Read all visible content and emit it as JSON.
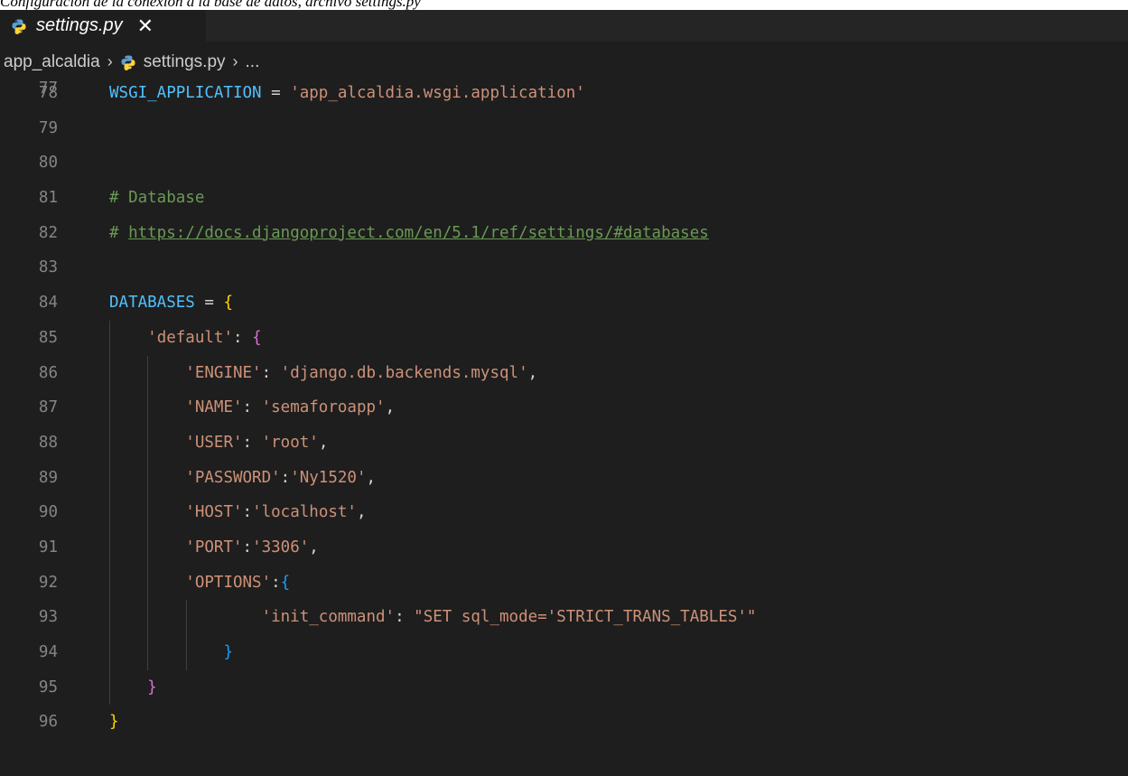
{
  "caption": "Configuración de la conexión a la base de datos, archivo settings.py",
  "tab": {
    "icon": "python-file-icon",
    "label": "settings.py",
    "close_label": "✕"
  },
  "breadcrumb": {
    "folder": "app_alcaldia",
    "sep": "›",
    "file": "settings.py",
    "more": "..."
  },
  "partial_line_number": "77",
  "lines": [
    {
      "n": "78",
      "segs": [
        [
          "WSGI_APPLICATION",
          "kw-var"
        ],
        [
          " = ",
          "op"
        ],
        [
          "'app_alcaldia.wsgi.application'",
          "str"
        ]
      ]
    },
    {
      "n": "79",
      "segs": []
    },
    {
      "n": "80",
      "segs": []
    },
    {
      "n": "81",
      "segs": [
        [
          "# Database",
          "cmt"
        ]
      ]
    },
    {
      "n": "82",
      "segs": [
        [
          "# ",
          "cmt"
        ],
        [
          "https://docs.djangoproject.com/en/5.1/ref/settings/#databases",
          "cmt link"
        ]
      ]
    },
    {
      "n": "83",
      "segs": []
    },
    {
      "n": "84",
      "segs": [
        [
          "DATABASES",
          "kw-var"
        ],
        [
          " = ",
          "op"
        ],
        [
          "{",
          "b1"
        ]
      ]
    },
    {
      "n": "85",
      "segs": [
        [
          "    ",
          "op"
        ],
        [
          "'default'",
          "str"
        ],
        [
          ": ",
          "op"
        ],
        [
          "{",
          "b2"
        ]
      ]
    },
    {
      "n": "86",
      "segs": [
        [
          "        ",
          "op"
        ],
        [
          "'ENGINE'",
          "str"
        ],
        [
          ": ",
          "op"
        ],
        [
          "'django.db.backends.mysql'",
          "str"
        ],
        [
          ",",
          "op"
        ]
      ]
    },
    {
      "n": "87",
      "segs": [
        [
          "        ",
          "op"
        ],
        [
          "'NAME'",
          "str"
        ],
        [
          ": ",
          "op"
        ],
        [
          "'semaforoapp'",
          "str"
        ],
        [
          ",",
          "op"
        ]
      ]
    },
    {
      "n": "88",
      "segs": [
        [
          "        ",
          "op"
        ],
        [
          "'USER'",
          "str"
        ],
        [
          ": ",
          "op"
        ],
        [
          "'root'",
          "str"
        ],
        [
          ",",
          "op"
        ]
      ]
    },
    {
      "n": "89",
      "segs": [
        [
          "        ",
          "op"
        ],
        [
          "'PASSWORD'",
          "str"
        ],
        [
          ":",
          "op"
        ],
        [
          "'Ny1520'",
          "str"
        ],
        [
          ",",
          "op"
        ]
      ]
    },
    {
      "n": "90",
      "segs": [
        [
          "        ",
          "op"
        ],
        [
          "'HOST'",
          "str"
        ],
        [
          ":",
          "op"
        ],
        [
          "'localhost'",
          "str"
        ],
        [
          ",",
          "op"
        ]
      ]
    },
    {
      "n": "91",
      "segs": [
        [
          "        ",
          "op"
        ],
        [
          "'PORT'",
          "str"
        ],
        [
          ":",
          "op"
        ],
        [
          "'3306'",
          "str"
        ],
        [
          ",",
          "op"
        ]
      ]
    },
    {
      "n": "92",
      "segs": [
        [
          "        ",
          "op"
        ],
        [
          "'OPTIONS'",
          "str"
        ],
        [
          ":",
          "op"
        ],
        [
          "{",
          "b3"
        ]
      ]
    },
    {
      "n": "93",
      "segs": [
        [
          "                ",
          "op"
        ],
        [
          "'init_command'",
          "str"
        ],
        [
          ": ",
          "op"
        ],
        [
          "\"SET sql_mode='STRICT_TRANS_TABLES'\"",
          "str"
        ]
      ]
    },
    {
      "n": "94",
      "segs": [
        [
          "            ",
          "op"
        ],
        [
          "}",
          "b3"
        ]
      ]
    },
    {
      "n": "95",
      "segs": [
        [
          "    ",
          "op"
        ],
        [
          "}",
          "b2"
        ]
      ]
    },
    {
      "n": "96",
      "segs": [
        [
          "}",
          "b1"
        ]
      ]
    }
  ],
  "colors": {
    "editor_bg": "#1e1e1e",
    "variable": "#4fc1ff",
    "string": "#ce9178",
    "comment": "#6a9955",
    "bracket_level_1": "#ffd700",
    "bracket_level_2": "#da70d6",
    "bracket_level_3": "#179fff"
  }
}
